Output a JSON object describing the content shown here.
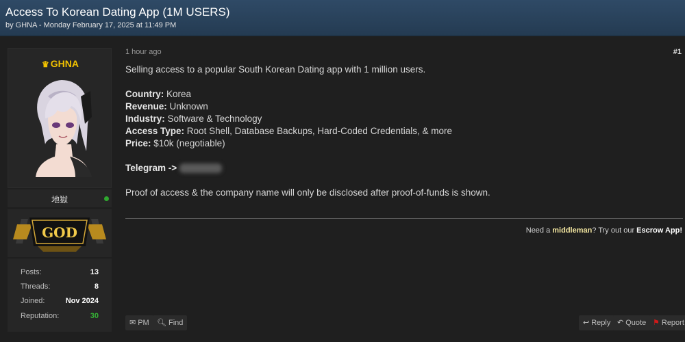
{
  "thread": {
    "title": "Access To Korean Dating App (1M USERS)",
    "meta": "by GHNA - Monday February 17, 2025 at 11:49 PM"
  },
  "user": {
    "name": "GHNA",
    "title": "地獄",
    "rank": "GOD",
    "stats": [
      {
        "label": "Posts:",
        "value": "13"
      },
      {
        "label": "Threads:",
        "value": "8"
      },
      {
        "label": "Joined:",
        "value": "Nov 2024"
      },
      {
        "label": "Reputation:",
        "value": "30"
      }
    ]
  },
  "post": {
    "time": "1 hour ago",
    "number": "#1",
    "intro": "Selling access to a popular South Korean Dating app with 1 million users.",
    "fields": [
      {
        "label": "Country:",
        "value": " Korea"
      },
      {
        "label": "Revenue:",
        "value": " Unknown"
      },
      {
        "label": "Industry:",
        "value": " Software & Technology"
      },
      {
        "label": "Access Type:",
        "value": " Root Shell, Database Backups, Hard-Coded Credentials, & more"
      },
      {
        "label": "Price:",
        "value": " $10k (negotiable)"
      }
    ],
    "telegram_label": "Telegram ->",
    "proof": "Proof of access & the company name will only be disclosed after proof-of-funds is shown."
  },
  "signature": {
    "pre": "Need a ",
    "middleman": "middleman",
    "mid": "? Try out our ",
    "escrow": "Escrow App!"
  },
  "actions": {
    "pm": "PM",
    "find": "Find",
    "reply": "Reply",
    "quote": "Quote",
    "report": "Report"
  }
}
